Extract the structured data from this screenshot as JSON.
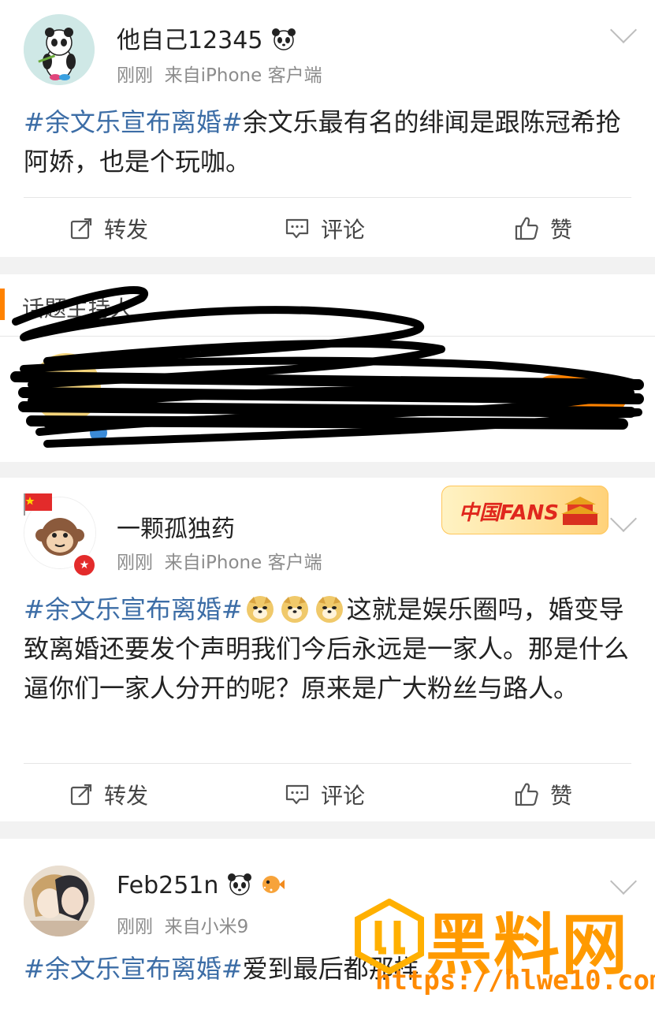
{
  "posts": [
    {
      "username": "他自己12345",
      "time": "刚刚",
      "source": "来自iPhone 客户端",
      "topic": "#余文乐宣布离婚#",
      "text": "余文乐最有名的绯闻是跟陈冠希抢阿娇，也是个玩咖。",
      "repost": "转发",
      "comment": "评论",
      "like": "赞"
    },
    {
      "username": "一颗孤独药",
      "time": "刚刚",
      "source": "来自iPhone 客户端",
      "badge": "中国FANS",
      "topic": "#余文乐宣布离婚#",
      "text": "这就是娱乐圈吗，婚变导致离婚还要发个声明我们今后永远是一家人。那是什么逼你们一家人分开的呢？原来是广大粉丝与路人。",
      "repost": "转发",
      "comment": "评论",
      "like": "赞"
    },
    {
      "username": "Feb251n",
      "time": "刚刚",
      "source": "来自小米9",
      "topic": "#余文乐宣布离婚#",
      "text": "爱到最后都那样"
    }
  ],
  "host_section": {
    "title": "话题主持人"
  },
  "watermark": {
    "brand": "黑料网",
    "url": "https://hlwe10.com"
  },
  "colors": {
    "topic": "#3c6da6",
    "accent_orange": "#ff8200",
    "watermark_orange": "#ff9a00"
  }
}
